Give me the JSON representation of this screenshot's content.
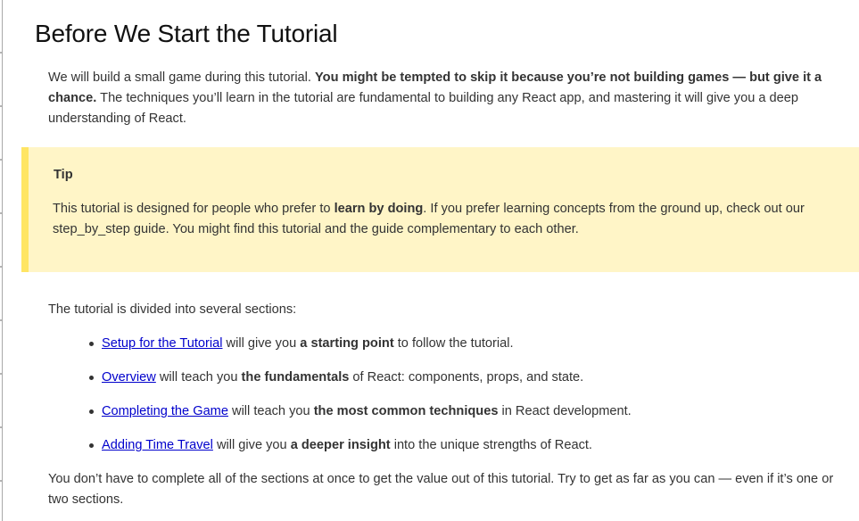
{
  "page": {
    "title": "Before We Start the Tutorial"
  },
  "intro": {
    "text1": "We will build a small game during this tutorial. ",
    "bold1": "You might be tempted to skip it because you’re not building games — but give it a chance.",
    "text2": " The techniques you’ll learn in the tutorial are fundamental to building any React app, and mastering it will give you a deep understanding of React."
  },
  "tip": {
    "title": "Tip",
    "text1": "This tutorial is designed for people who prefer to ",
    "bold1": "learn by doing",
    "text2": ". If you prefer learning concepts from the ground up, check out our step_by_step guide. You might find this tutorial and the guide complementary to each other."
  },
  "sections_intro": "The tutorial is divided into several sections:",
  "sections": [
    {
      "link": "Setup for the Tutorial",
      "pre": " will give you ",
      "bold": "a starting point",
      "post": " to follow the tutorial."
    },
    {
      "link": "Overview",
      "pre": " will teach you ",
      "bold": "the fundamentals",
      "post": " of React: components, props, and state."
    },
    {
      "link": "Completing the Game",
      "pre": " will teach you ",
      "bold": "the most common techniques",
      "post": " in React development."
    },
    {
      "link": "Adding Time Travel",
      "pre": " will give you ",
      "bold": "a deeper insight",
      "post": " into the unique strengths of React."
    }
  ],
  "outro": "You don’t have to complete all of the sections at once to get the value out of this tutorial. Try to get as far as you can — even if it’s one or two sections."
}
